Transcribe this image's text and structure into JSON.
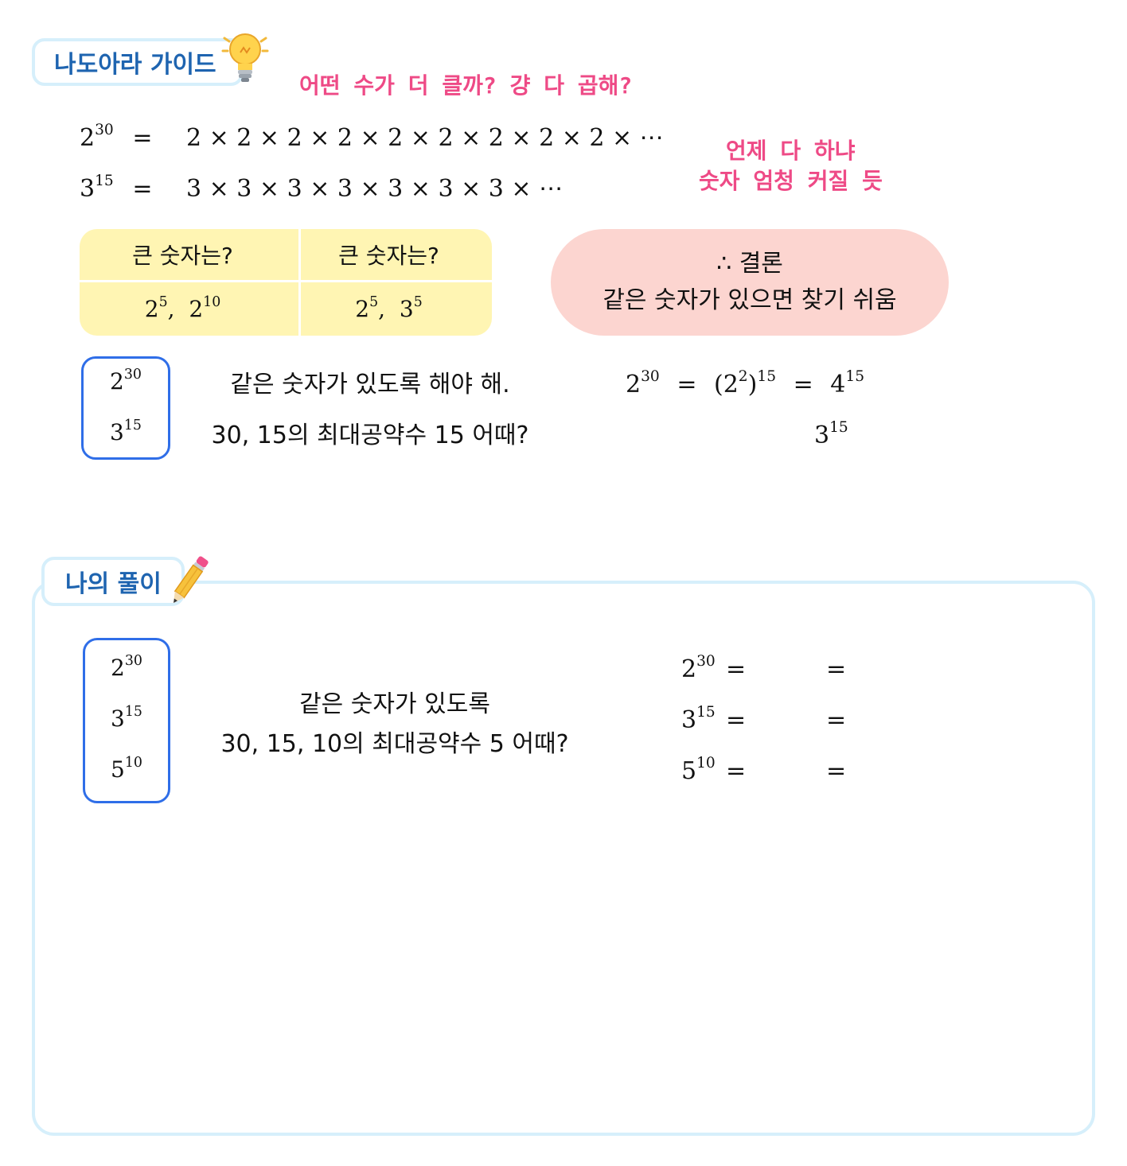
{
  "guide": {
    "tab_label": "나도아라 가이드",
    "bubble": "어떤 수가 더 클까? 걍 다 곱해?",
    "line1": {
      "lhs_base": "2",
      "lhs_exp": "30",
      "eq": "=",
      "rhs": "2 × 2 × 2 × 2 × 2 × 2 × 2 × 2 × 2 × ⋯"
    },
    "line2": {
      "lhs_base": "3",
      "lhs_exp": "15",
      "eq": "=",
      "rhs": "3 × 3 × 3 × 3 × 3 × 3 × 3 × ⋯"
    },
    "note1": "언제 다 하냐",
    "note2": "숫자 엄청 커질 듯",
    "table": {
      "header_left": "큰 숫자는?",
      "header_right": "큰 숫자는?",
      "left_a_base": "2",
      "left_a_exp": "5",
      "left_b_base": "2",
      "left_b_exp": "10",
      "right_a_base": "2",
      "right_a_exp": "5",
      "right_b_base": "3",
      "right_b_exp": "5",
      "sep": ","
    },
    "conclusion": {
      "line1": "∴ 결론",
      "line2": "같은 숫자가 있으면 찾기 쉬움"
    },
    "box": {
      "a_base": "2",
      "a_exp": "30",
      "b_base": "3",
      "b_exp": "15"
    },
    "hint1": "같은 숫자가 있도록 해야 해.",
    "hint2": "30, 15의 최대공약수 15 어때?",
    "eq1": {
      "base": "2",
      "exp": "30",
      "eq": "=",
      "mid_open": "(2",
      "mid_inner_exp": "2",
      "mid_close": ")",
      "mid_exp": "15",
      "eq2": "=",
      "res_base": "4",
      "res_exp": "15"
    },
    "eq2": {
      "base": "3",
      "exp": "15"
    }
  },
  "solution": {
    "tab_label": "나의 풀이",
    "box": {
      "a_base": "2",
      "a_exp": "30",
      "b_base": "3",
      "b_exp": "15",
      "c_base": "5",
      "c_exp": "10"
    },
    "hint1": "같은 숫자가 있도록",
    "hint2": "30, 15, 10의 최대공약수 5 어때?",
    "rows": [
      {
        "base": "2",
        "exp": "30",
        "eq1": "=",
        "eq2": "="
      },
      {
        "base": "3",
        "exp": "15",
        "eq1": "=",
        "eq2": "="
      },
      {
        "base": "5",
        "exp": "10",
        "eq1": "=",
        "eq2": "="
      }
    ]
  },
  "colors": {
    "tab_border": "#d6effb",
    "tab_text": "#1e64b0",
    "pink": "#ee4a86",
    "yellow": "#fff5b3",
    "salmon": "#fcd5d0",
    "blue_box": "#2f6ee8"
  },
  "icons": {
    "guide": "light-bulb-icon",
    "solution": "pencil-icon"
  }
}
